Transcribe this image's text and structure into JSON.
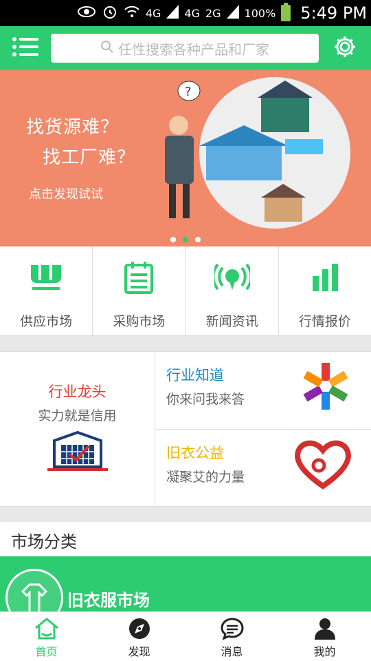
{
  "status_bar": {
    "battery": "100%",
    "time": "5:49 PM",
    "net1": "4G",
    "net2": "4G",
    "net3": "2G"
  },
  "header": {
    "search_placeholder": "任性搜索各种产品和厂家"
  },
  "banner": {
    "line1": "找货源难？",
    "line2": "找工厂难？",
    "line3": "点击发现试试"
  },
  "quick_nav": [
    {
      "label": "供应市场",
      "icon": "supply-icon"
    },
    {
      "label": "采购市场",
      "icon": "purchase-list-icon"
    },
    {
      "label": "新闻资讯",
      "icon": "broadcast-icon"
    },
    {
      "label": "行情报价",
      "icon": "bar-chart-icon"
    }
  ],
  "promo": {
    "left": {
      "title": "行业龙头",
      "subtitle": "实力就是信用"
    },
    "right_top": {
      "title": "行业知道",
      "subtitle": "你来问我来答"
    },
    "right_bottom": {
      "title": "旧衣公益",
      "subtitle": "凝聚艾的力量"
    }
  },
  "section": {
    "title": "市场分类"
  },
  "market": {
    "title": "旧衣服市场"
  },
  "tabs": [
    {
      "label": "首页",
      "icon": "home-icon"
    },
    {
      "label": "发现",
      "icon": "discover-icon"
    },
    {
      "label": "消息",
      "icon": "message-icon"
    },
    {
      "label": "我的",
      "icon": "user-icon"
    }
  ],
  "colors": {
    "primary": "#2ecc71",
    "banner": "#f08a6b",
    "red": "#e53935",
    "blue": "#1e88c8",
    "yellow": "#f0b400"
  }
}
